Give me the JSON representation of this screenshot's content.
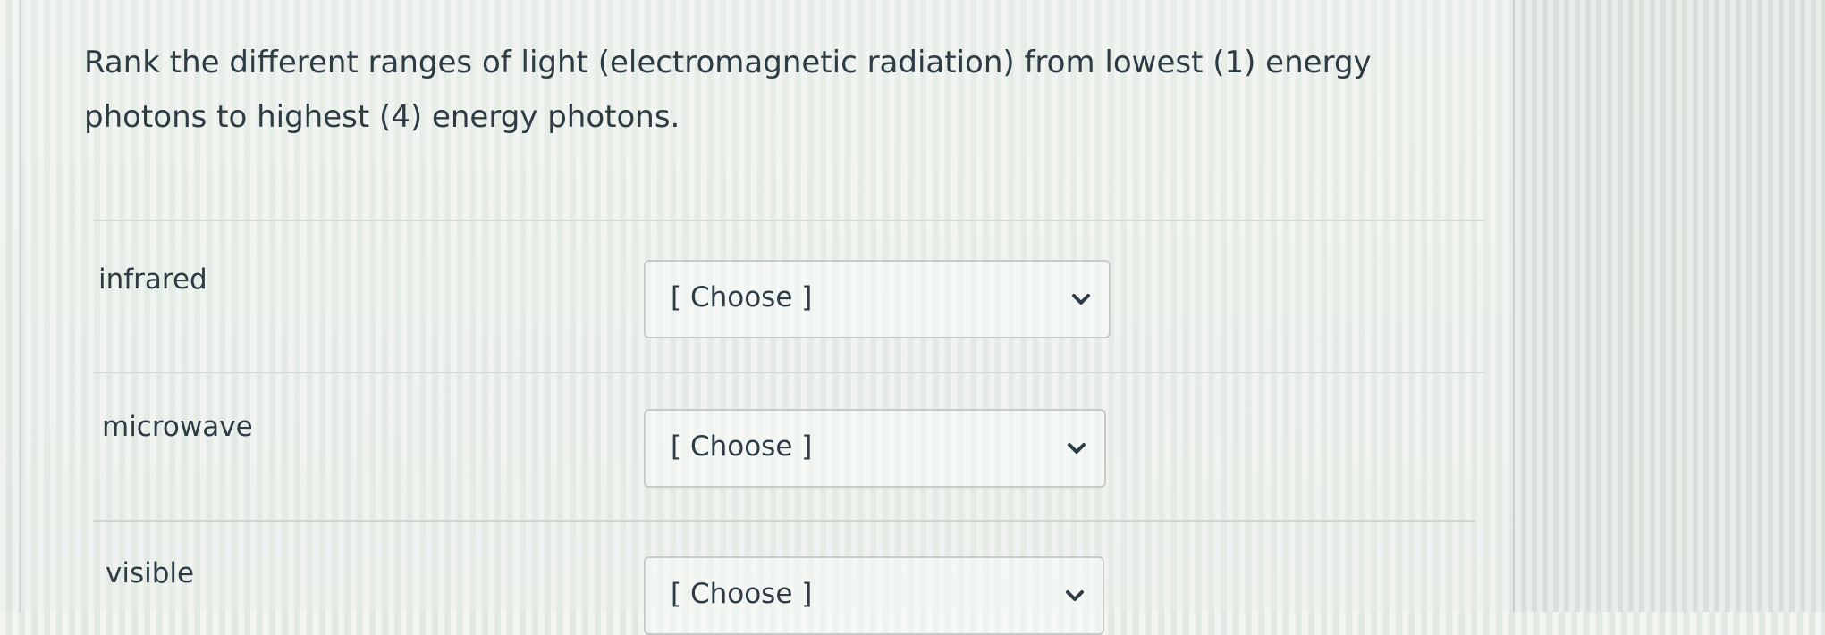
{
  "question": {
    "text": "Rank the different ranges of light (electromagnetic radiation) from lowest (1) energy photons to highest (4) energy photons."
  },
  "items": [
    {
      "label": "infrared",
      "selected": "[ Choose ]"
    },
    {
      "label": "microwave",
      "selected": "[ Choose ]"
    },
    {
      "label": "visible",
      "selected": "[ Choose ]"
    }
  ],
  "colors": {
    "text": "#2d3b45",
    "border": "#c6cbc7",
    "divider": "#cfd5d1"
  },
  "icons": {
    "dropdown": "chevron-down-icon"
  }
}
